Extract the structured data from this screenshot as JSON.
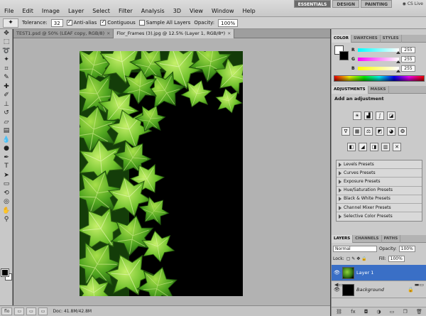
{
  "menu": [
    "File",
    "Edit",
    "Image",
    "Layer",
    "Select",
    "Filter",
    "Analysis",
    "3D",
    "View",
    "Window",
    "Help"
  ],
  "workspace": {
    "zoom": "12.5",
    "buttons": [
      "ESSENTIALS",
      "DESIGN",
      "PAINTING"
    ],
    "cs_live": "CS Live"
  },
  "options": {
    "tolerance_label": "Tolerance:",
    "tolerance_value": "32",
    "anti_alias": "Anti-alias",
    "contiguous": "Contiguous",
    "sample_all": "Sample All Layers",
    "opacity_label": "Opacity:",
    "opacity_value": "100%"
  },
  "documents": {
    "tabs": [
      {
        "label": "TEST1.psd @ 50% (LEAF copy, RGB/8)",
        "active": false
      },
      {
        "label": "Flor_Frames (3).jpg @ 12.5% (Layer 1, RGB/8*)",
        "active": true
      }
    ]
  },
  "status": {
    "tabs": [
      "flo",
      "",
      "",
      ""
    ],
    "info": "Doc: 41.8M/42.8M"
  },
  "color_panel": {
    "tabs": [
      "COLOR",
      "SWATCHES",
      "STYLES"
    ],
    "channels": [
      {
        "label": "R",
        "value": "255",
        "gradient": "linear-gradient(to right, #0ff, #fff)"
      },
      {
        "label": "G",
        "value": "255",
        "gradient": "linear-gradient(to right, #f0f, #fff)"
      },
      {
        "label": "B",
        "value": "255",
        "gradient": "linear-gradient(to right, #ff0, #fff)"
      }
    ]
  },
  "adjustments": {
    "tabs": [
      "ADJUSTMENTS",
      "MASKS"
    ],
    "title": "Add an adjustment",
    "presets": [
      "Levels Presets",
      "Curves Presets",
      "Exposure Presets",
      "Hue/Saturation Presets",
      "Black & White Presets",
      "Channel Mixer Presets",
      "Selective Color Presets"
    ]
  },
  "layers_panel": {
    "tabs": [
      "LAYERS",
      "CHANNELS",
      "PATHS"
    ],
    "blend_mode": "Normal",
    "opacity_label": "Opacity:",
    "opacity_value": "100%",
    "lock_label": "Lock:",
    "fill_label": "Fill:",
    "fill_value": "100%",
    "layers": [
      {
        "name": "Layer 1",
        "selected": true
      },
      {
        "name": "Background",
        "selected": false
      }
    ]
  },
  "colors": {
    "selection": "#3a6fc6",
    "canvas_bg": "#000000",
    "workspace": "#b2b2b2"
  }
}
